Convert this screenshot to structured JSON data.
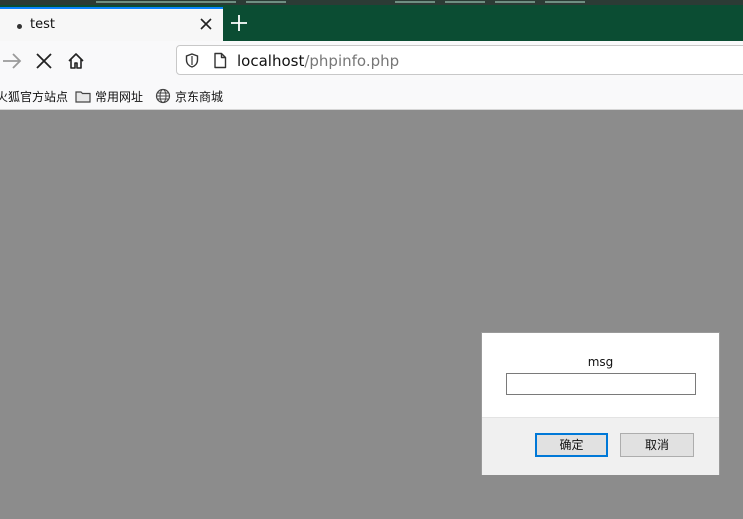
{
  "browser": {
    "tab": {
      "title": "test"
    },
    "url": {
      "host": "localhost",
      "path": "/phpinfo.php"
    },
    "bookmarks": [
      {
        "label": "火狐官方站点",
        "icon": "firefox-icon"
      },
      {
        "label": "常用网址",
        "icon": "folder-icon"
      },
      {
        "label": "京东商城",
        "icon": "globe-icon"
      }
    ]
  },
  "dialog": {
    "message": "msg",
    "input_value": "",
    "ok_label": "确定",
    "cancel_label": "取消"
  },
  "colors": {
    "tabbar": "#0b4d33",
    "accent": "#0a84ff",
    "backdrop": "#8c8c8c",
    "ok_border": "#0078d7"
  }
}
